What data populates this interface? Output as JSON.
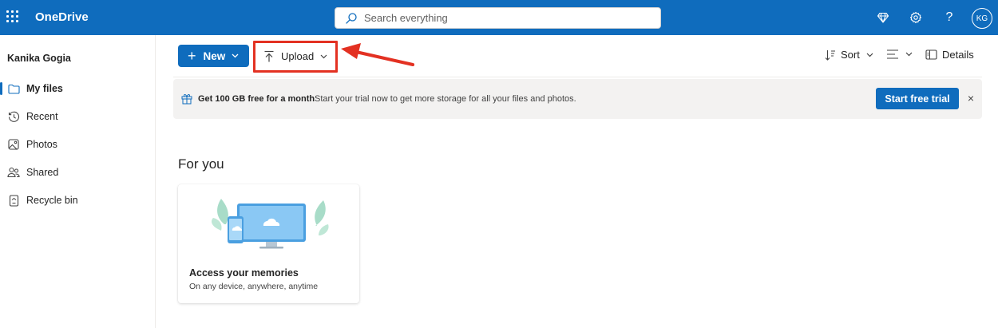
{
  "app": {
    "name": "OneDrive"
  },
  "search": {
    "placeholder": "Search everything"
  },
  "header": {
    "avatar_initials": "KG",
    "icons": [
      "waffle-icon",
      "premium-diamond-icon",
      "settings-gear-icon",
      "help-icon"
    ]
  },
  "nav": {
    "user": "Kanika Gogia",
    "items": [
      {
        "label": "My files",
        "icon": "folder-icon",
        "active": true
      },
      {
        "label": "Recent",
        "icon": "clock-icon",
        "active": false
      },
      {
        "label": "Photos",
        "icon": "image-icon",
        "active": false
      },
      {
        "label": "Shared",
        "icon": "people-icon",
        "active": false
      },
      {
        "label": "Recycle bin",
        "icon": "trash-icon",
        "active": false
      }
    ]
  },
  "commands": {
    "new_label": "New",
    "upload_label": "Upload",
    "sort_label": "Sort",
    "details_label": "Details"
  },
  "banner": {
    "heading": "Get 100 GB free for a month",
    "text": "Start your trial now to get more storage for all your files and photos.",
    "cta": "Start free trial",
    "close": "×"
  },
  "for_you": {
    "title": "For you",
    "cards": [
      {
        "title": "Access your memories",
        "subtitle": "On any device, anywhere, anytime"
      }
    ]
  },
  "colors": {
    "brand": "#0f6cbd",
    "annotation": "#e33122"
  }
}
